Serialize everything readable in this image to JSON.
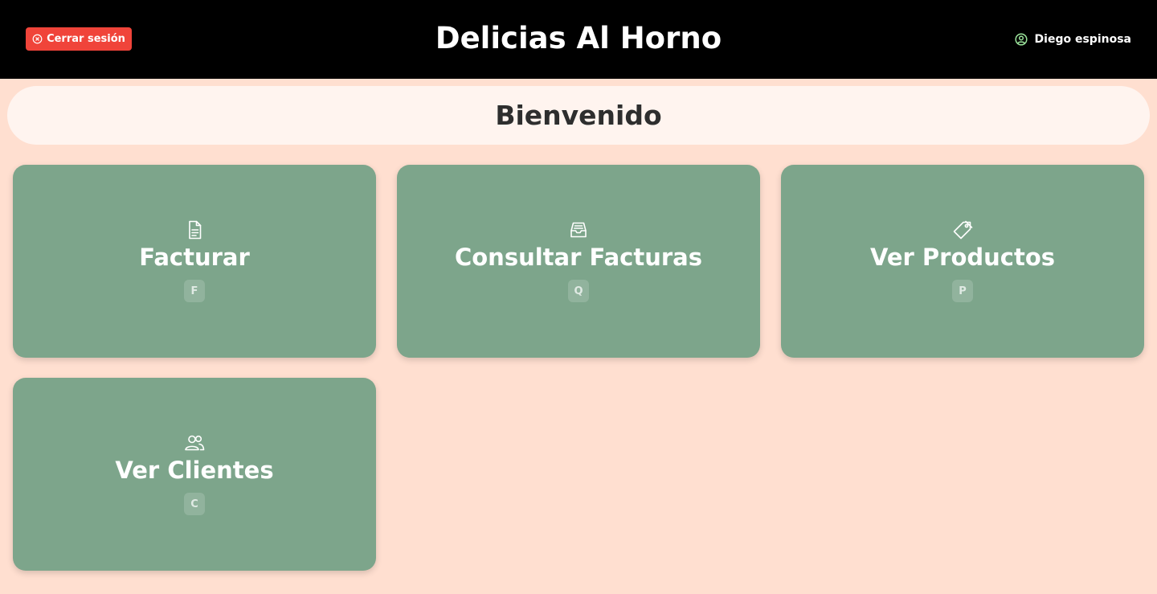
{
  "header": {
    "logout_label": "Cerrar sesión",
    "app_title": "Delicias Al Horno",
    "user_name": "Diego espinosa"
  },
  "welcome": "Bienvenido",
  "cards": [
    {
      "label": "Facturar",
      "shortcut": "F",
      "icon": "document-icon"
    },
    {
      "label": "Consultar Facturas",
      "shortcut": "Q",
      "icon": "inbox-icon"
    },
    {
      "label": "Ver Productos",
      "shortcut": "P",
      "icon": "tag-icon"
    },
    {
      "label": "Ver Clientes",
      "shortcut": "C",
      "icon": "users-icon"
    }
  ],
  "colors": {
    "header_bg": "#000000",
    "page_bg": "#ffdfd0",
    "welcome_bg": "#fff4ef",
    "card_bg": "#7da58b",
    "logout_bg": "#f0443a",
    "user_icon": "#9be39b"
  }
}
